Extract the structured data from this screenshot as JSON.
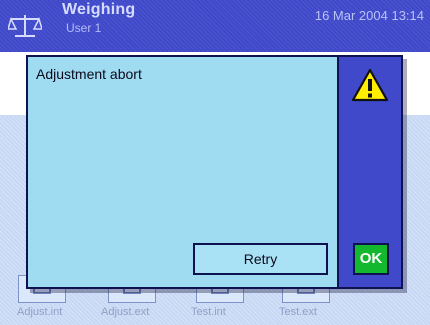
{
  "header": {
    "title": "Weighing",
    "user": "User 1",
    "datetime": "16 Mar 2004  13:14",
    "icon": "scale-icon"
  },
  "dialog": {
    "message": "Adjustment abort",
    "icon": "warning-icon",
    "retry_label": "Retry",
    "ok_label": "OK"
  },
  "function_keys": [
    {
      "label": "Adjust.int",
      "icon": "adjust-int-icon"
    },
    {
      "label": "Adjust.ext",
      "icon": "adjust-ext-icon"
    },
    {
      "label": "Test.int",
      "icon": "test-int-icon"
    },
    {
      "label": "Test.ext",
      "icon": "test-ext-icon"
    }
  ],
  "colors": {
    "titlebar": "#3f49c9",
    "dialog_body": "#9fdcf2",
    "ok_button": "#14b82e",
    "warning_yellow": "#ffee00"
  }
}
